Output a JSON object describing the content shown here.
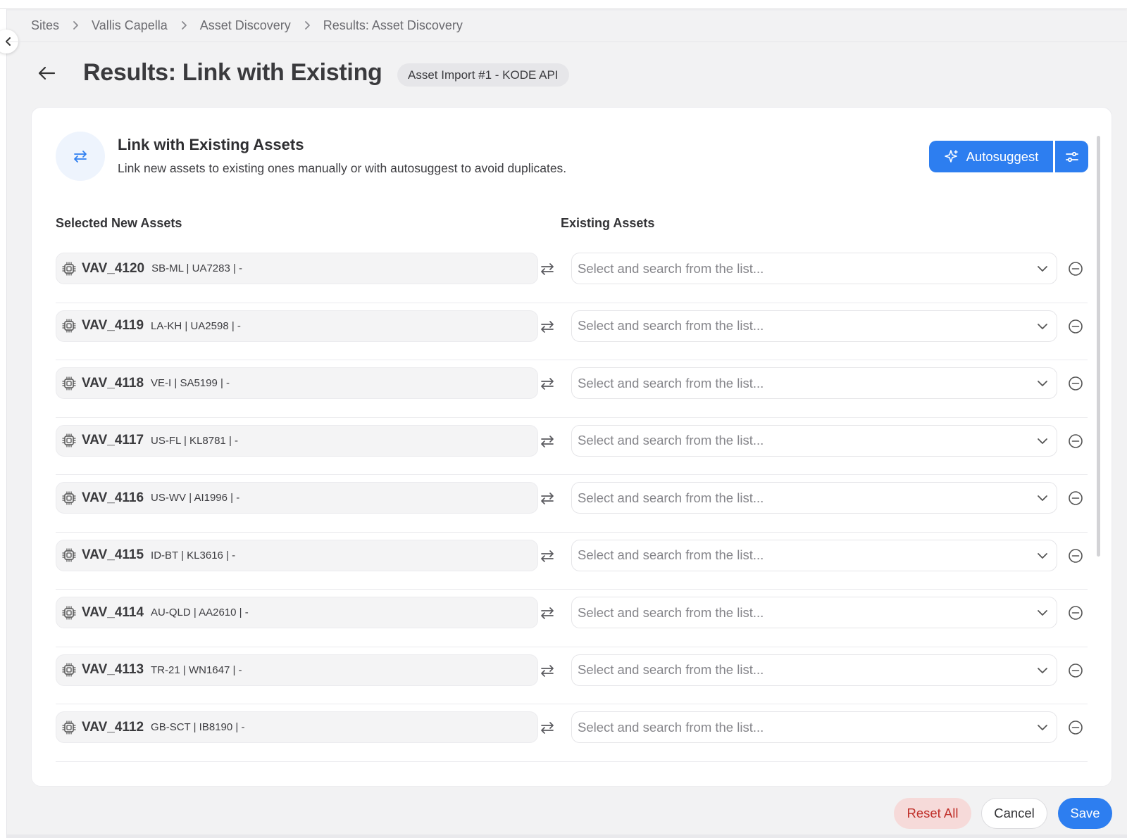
{
  "breadcrumb": [
    {
      "label": "Sites"
    },
    {
      "label": "Vallis Capella"
    },
    {
      "label": "Asset Discovery"
    },
    {
      "label": "Results: Asset Discovery"
    }
  ],
  "header": {
    "title": "Results: Link with Existing",
    "badge": "Asset Import #1 - KODE API"
  },
  "card": {
    "title": "Link with Existing Assets",
    "subtitle": "Link new assets to existing ones manually or with autosuggest to avoid duplicates.",
    "autosuggest_label": "Autosuggest",
    "col_new": "Selected New Assets",
    "col_existing": "Existing Assets"
  },
  "rows": [
    {
      "name": "VAV_4120",
      "meta": "SB-ML | UA7283 | -",
      "placeholder": "Select and search from the list..."
    },
    {
      "name": "VAV_4119",
      "meta": "LA-KH | UA2598 | -",
      "placeholder": "Select and search from the list..."
    },
    {
      "name": "VAV_4118",
      "meta": "VE-I | SA5199 | -",
      "placeholder": "Select and search from the list..."
    },
    {
      "name": "VAV_4117",
      "meta": "US-FL | KL8781 | -",
      "placeholder": "Select and search from the list..."
    },
    {
      "name": "VAV_4116",
      "meta": "US-WV | AI1996 | -",
      "placeholder": "Select and search from the list..."
    },
    {
      "name": "VAV_4115",
      "meta": "ID-BT | KL3616 | -",
      "placeholder": "Select and search from the list..."
    },
    {
      "name": "VAV_4114",
      "meta": "AU-QLD | AA2610 | -",
      "placeholder": "Select and search from the list..."
    },
    {
      "name": "VAV_4113",
      "meta": "TR-21 | WN1647 | -",
      "placeholder": "Select and search from the list..."
    },
    {
      "name": "VAV_4112",
      "meta": "GB-SCT | IB8190 | -",
      "placeholder": "Select and search from the list..."
    }
  ],
  "footer": {
    "reset_label": "Reset All",
    "cancel_label": "Cancel",
    "save_label": "Save"
  },
  "icons": {
    "collapse": "chevron-left-icon",
    "breadcrumb_separator": "chevron-right-icon",
    "back": "arrow-left-icon",
    "card": "swap-arrows-icon",
    "autosuggest": "sparkle-icon",
    "settings": "sliders-icon",
    "asset": "chip-icon",
    "link": "swap-arrows-icon",
    "dropdown": "chevron-down-icon",
    "remove": "minus-circle-icon"
  },
  "colors": {
    "accent": "#2d7ef0",
    "danger_text": "#c0302a",
    "danger_bg": "#f6dad9"
  }
}
